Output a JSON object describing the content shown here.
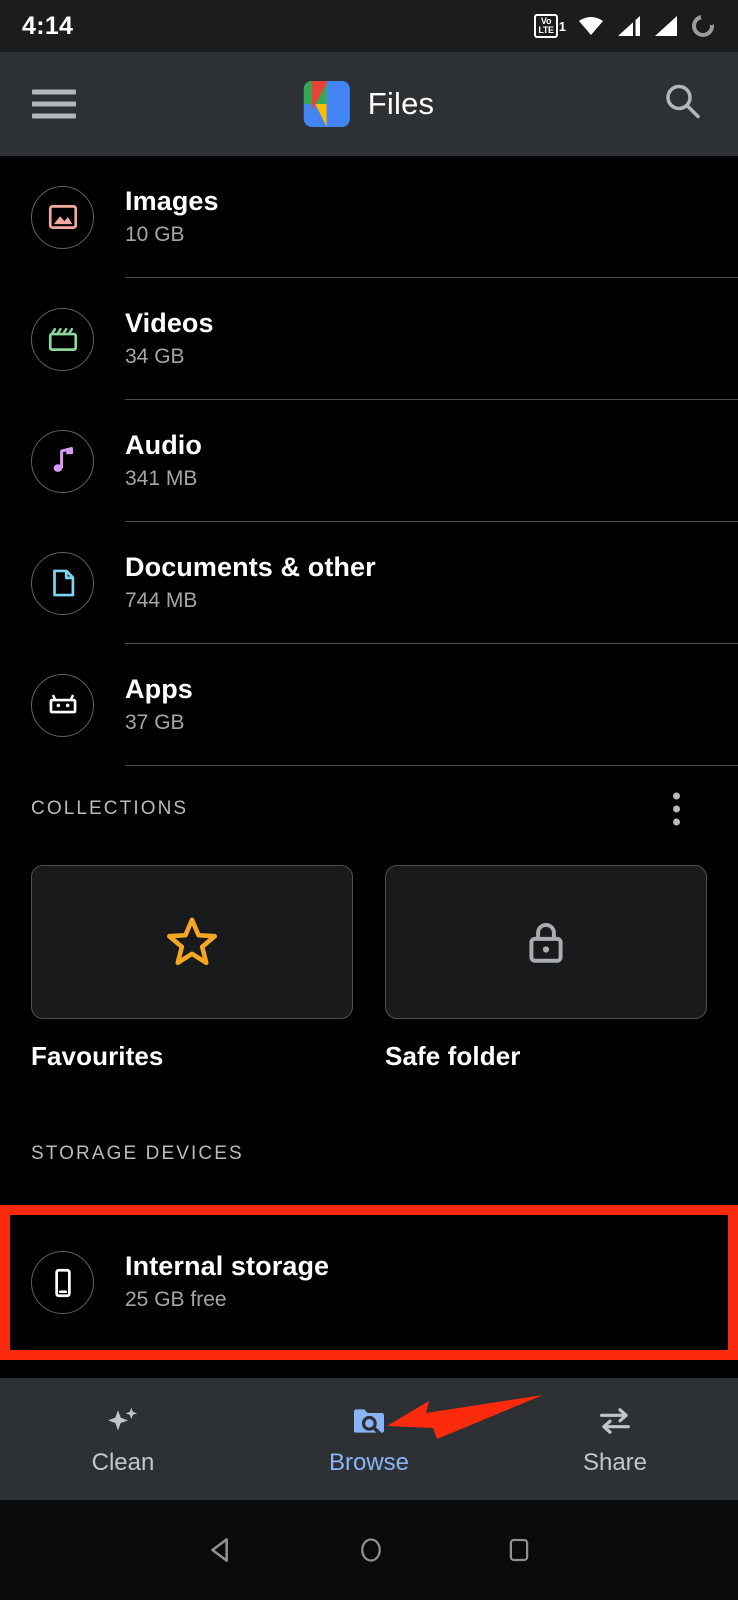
{
  "status_bar": {
    "time": "4:14",
    "icons": [
      {
        "name": "volte-icon",
        "line1": "Vo",
        "line2": "LTE",
        "sim": "1"
      },
      {
        "name": "wifi-icon"
      },
      {
        "name": "signal-bars-sim1-icon"
      },
      {
        "name": "signal-bars-sim2-icon"
      },
      {
        "name": "battery-circle-icon"
      }
    ]
  },
  "app_bar": {
    "menu_icon": "hamburger-menu-icon",
    "title": "Files",
    "logo_icon": "files-app-logo",
    "search_icon": "search-icon"
  },
  "categories": [
    {
      "title": "Images",
      "size": "10 GB",
      "icon": "image-icon",
      "color": "#f3a9a0"
    },
    {
      "title": "Videos",
      "size": "34 GB",
      "icon": "video-icon",
      "color": "#8cd7a0"
    },
    {
      "title": "Audio",
      "size": "341 MB",
      "icon": "audio-icon",
      "color": "#d79af5"
    },
    {
      "title": "Documents & other",
      "size": "744 MB",
      "icon": "document-icon",
      "color": "#7fd5f0"
    },
    {
      "title": "Apps",
      "size": "37 GB",
      "icon": "android-icon",
      "color": "#ffffff"
    }
  ],
  "collections_section": {
    "header": "COLLECTIONS",
    "overflow_icon": "more-options-icon",
    "items": [
      {
        "label": "Favourites",
        "icon": "star-icon",
        "color": "#f5a623"
      },
      {
        "label": "Safe folder",
        "icon": "lock-icon",
        "color": "#a9acb0"
      }
    ]
  },
  "storage_section": {
    "header": "STORAGE DEVICES",
    "items": [
      {
        "title": "Internal storage",
        "subtitle": "25 GB free",
        "icon": "phone-icon",
        "highlighted": true
      }
    ]
  },
  "bottom_nav": {
    "items": [
      {
        "label": "Clean",
        "icon": "sparkles-icon",
        "active": false
      },
      {
        "label": "Browse",
        "icon": "folder-search-icon",
        "active": true
      },
      {
        "label": "Share",
        "icon": "share-transfer-icon",
        "active": false
      }
    ]
  },
  "system_nav": {
    "items": [
      {
        "name": "back-button",
        "icon": "triangle-back-icon"
      },
      {
        "name": "home-button",
        "icon": "circle-home-icon"
      },
      {
        "name": "recents-button",
        "icon": "square-recents-icon"
      }
    ]
  },
  "annotations": {
    "highlight_color": "#fc2a0c",
    "arrow_target": "Browse"
  }
}
